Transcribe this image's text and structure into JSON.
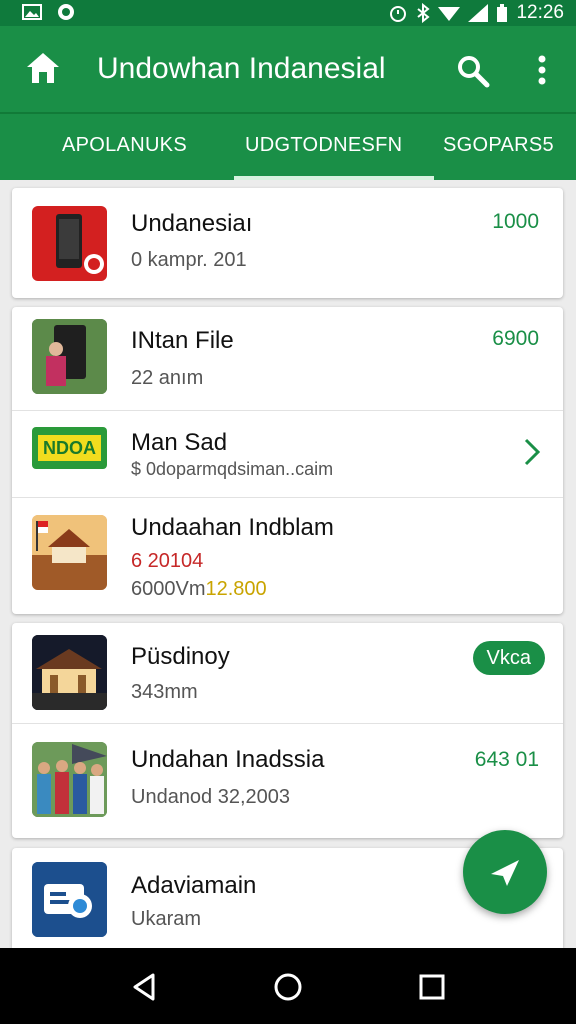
{
  "status_bar": {
    "time": "12:26"
  },
  "app_bar": {
    "title": "Undowhan Indanesial"
  },
  "tabs": [
    {
      "label": "APOLANUKS"
    },
    {
      "label": "UDGTODNESFN"
    },
    {
      "label": "SGOPARS5"
    }
  ],
  "list": [
    {
      "title": "Undanesiaı",
      "subtitle": "0 kampr. 201",
      "value": "1000"
    },
    {
      "title": "INtan File",
      "subtitle": "22 anım",
      "value": "6900"
    },
    {
      "title": "Man Sad",
      "subtitle": "$ 0doparmqdsiman..caim",
      "thumb_text": "NDOA"
    },
    {
      "title": "Undaahan Indblam",
      "subtitle_line1": "6 20104",
      "subtitle_line2_a": "6000Vm",
      "subtitle_line2_b": "12.800"
    },
    {
      "title": "Püsdinoy",
      "subtitle": "343mm",
      "badge": "Vkca"
    },
    {
      "title": "Undahan Inadssia",
      "subtitle": "Undanod 32,2003",
      "value": "643 01"
    },
    {
      "title": "Adaviamain",
      "subtitle": "Ukaram"
    }
  ],
  "colors": {
    "primary": "#1a8f47",
    "status_bar": "#0f7a3c",
    "accent_value": "#1a8f47"
  }
}
